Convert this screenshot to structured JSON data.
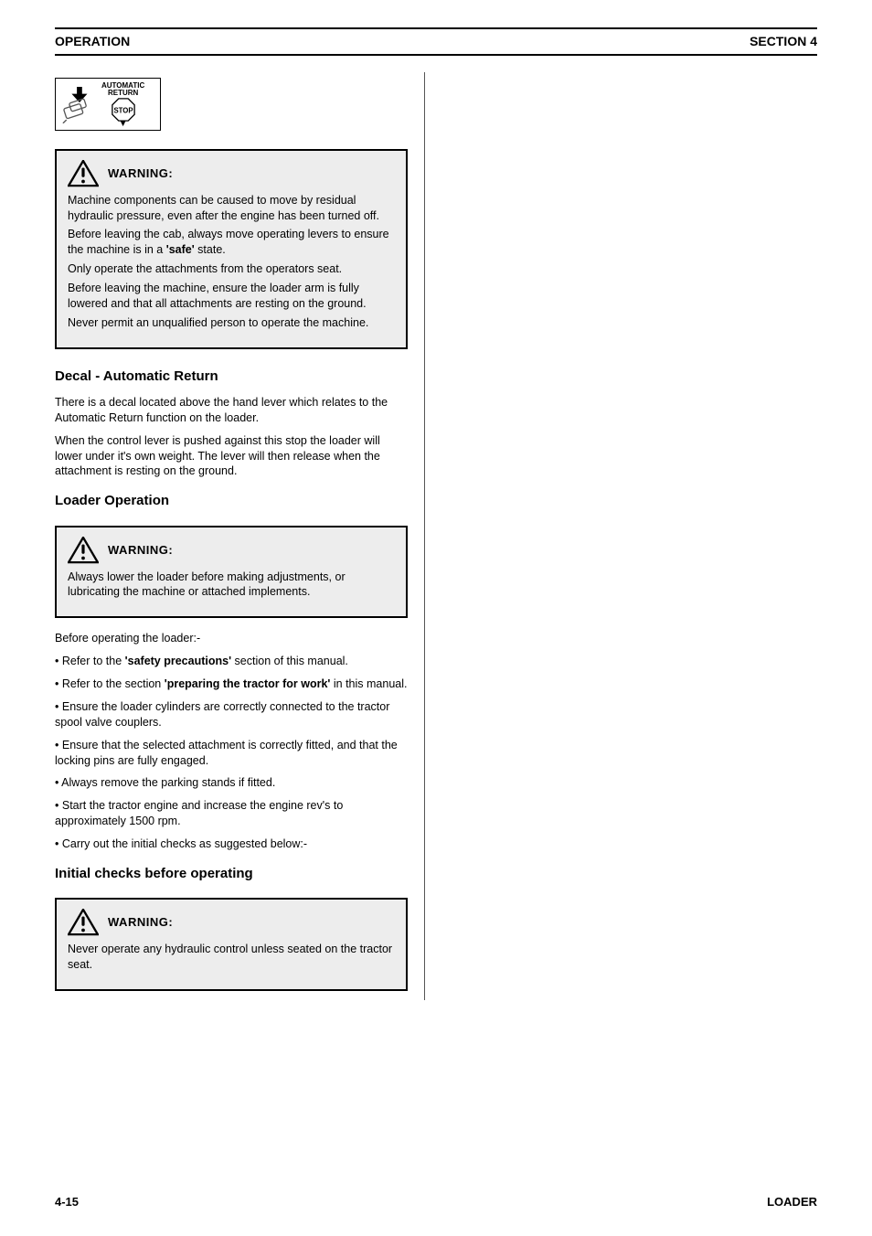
{
  "header": {
    "left": "OPERATION",
    "right": "SECTION 4"
  },
  "info_badge": {
    "line1": "AUTOMATIC",
    "line2": "RETURN",
    "stop": "STOP"
  },
  "warn1": {
    "label": "WARNING:",
    "p1": "Machine components can be caused to move by residual hydraulic pressure, even after the engine has been turned off.",
    "p2_a": "Before leaving the cab, always move operating levers to ensure the machine is in a",
    "p2_b": "'safe'",
    "p2_c": "state.",
    "p3": "Only operate the attachments from the operators seat.",
    "p4": "Before leaving the machine, ensure the loader arm is fully lowered and that all attachments are resting on the ground.",
    "p5": "Never permit an unqualified person to operate the machine."
  },
  "decal": {
    "title": "Decal - Automatic Return",
    "p1": "There is a decal located above the hand lever which relates to the Automatic Return function on the loader.",
    "p2": "When the control lever is pushed against this stop the loader will lower under it's own weight. The lever will then release when the attachment is resting on the ground."
  },
  "loader": {
    "title": "Loader Operation",
    "warn_label": "WARNING:",
    "warn_text": "Always lower the loader before making adjustments, or lubricating the machine or attached implements.",
    "intro": "Before operating the loader:-",
    "b1_a": "Refer to the ",
    "b1_b": "'safety precautions'",
    "b1_c": " section of this manual.",
    "b2_a": "Refer to the section ",
    "b2_b": "'preparing the tractor for work'",
    "b2_c": " in this manual.",
    "b3": "Ensure the loader cylinders are correctly connected to the tractor spool valve couplers.",
    "b4": "Ensure that the selected attachment is correctly fitted, and that the locking pins are fully engaged.",
    "b5": "Always remove the parking stands if fitted.",
    "b6": "Start the tractor engine and increase the engine rev's to approximately 1500 rpm.",
    "b7": "Carry out the initial checks as suggested below:-"
  },
  "initial": {
    "title": "Initial checks before operating",
    "warn_label": "WARNING:",
    "warn_text": "Never operate any hydraulic control unless seated on the tractor seat."
  },
  "footer": {
    "left": "4-15",
    "right": "LOADER"
  }
}
